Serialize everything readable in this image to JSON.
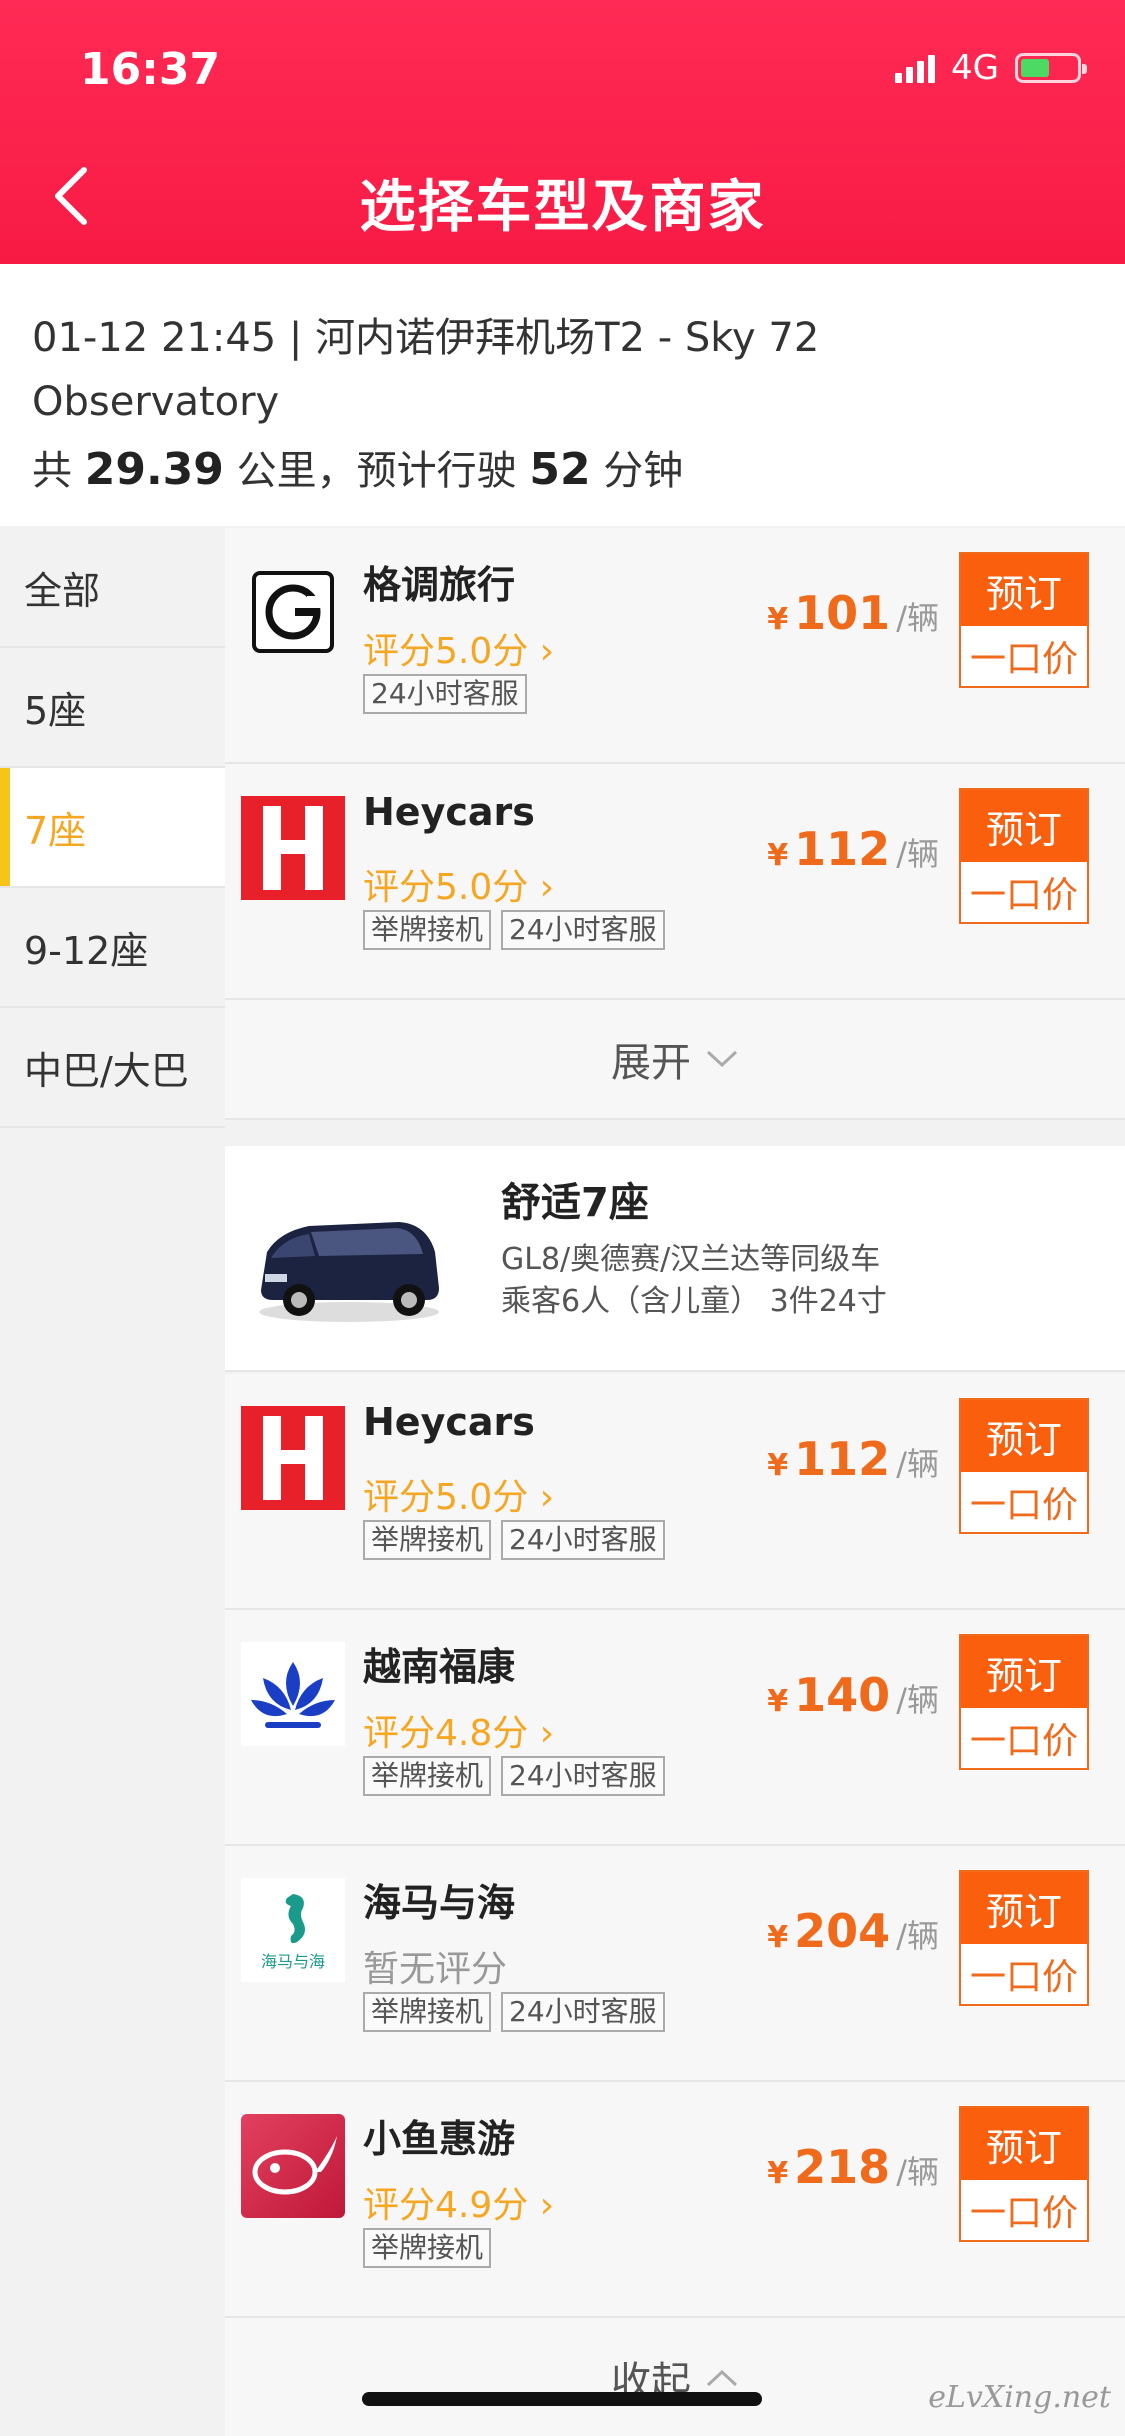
{
  "status": {
    "time": "16:37",
    "network": "4G"
  },
  "header": {
    "title": "选择车型及商家"
  },
  "trip": {
    "route": "01-12 21:45 | 河内诺伊拜机场T2 - Sky 72 Observatory",
    "summary_prefix": "共",
    "distance": "29.39",
    "distance_unit": "公里，预计行驶",
    "duration": "52",
    "duration_unit": "分钟"
  },
  "sidebar": {
    "items": [
      {
        "label": "全部"
      },
      {
        "label": "5座"
      },
      {
        "label": "7座"
      },
      {
        "label": "9-12座"
      },
      {
        "label": "中巴/大巴"
      }
    ],
    "active_index": 2
  },
  "group1": {
    "vendors": [
      {
        "name": "格调旅行",
        "rating": "评分5.0分",
        "tags": [
          "24小时客服"
        ],
        "currency": "¥",
        "price": "101",
        "unit": "/辆",
        "book": "预订",
        "fixed": "一口价"
      },
      {
        "name": "Heycars",
        "rating": "评分5.0分",
        "tags": [
          "举牌接机",
          "24小时客服"
        ],
        "currency": "¥",
        "price": "112",
        "unit": "/辆",
        "book": "预订",
        "fixed": "一口价"
      }
    ],
    "expand_label": "展开"
  },
  "car": {
    "title": "舒适7座",
    "models": "GL8/奥德赛/汉兰达等同级车",
    "capacity": "乘客6人（含儿童） 3件24寸"
  },
  "group2": {
    "vendors": [
      {
        "name": "Heycars",
        "rating": "评分5.0分",
        "tags": [
          "举牌接机",
          "24小时客服"
        ],
        "currency": "¥",
        "price": "112",
        "unit": "/辆",
        "book": "预订",
        "fixed": "一口价"
      },
      {
        "name": "越南福康",
        "rating": "评分4.8分",
        "tags": [
          "举牌接机",
          "24小时客服"
        ],
        "currency": "¥",
        "price": "140",
        "unit": "/辆",
        "book": "预订",
        "fixed": "一口价"
      },
      {
        "name": "海马与海",
        "rating": "暂无评分",
        "tags": [
          "举牌接机",
          "24小时客服"
        ],
        "currency": "¥",
        "price": "204",
        "unit": "/辆",
        "book": "预订",
        "fixed": "一口价",
        "logo_text": "海马与海"
      },
      {
        "name": "小鱼惠游",
        "rating": "评分4.9分",
        "tags": [
          "举牌接机"
        ],
        "currency": "¥",
        "price": "218",
        "unit": "/辆",
        "book": "预订",
        "fixed": "一口价"
      }
    ],
    "collapse_label": "收起"
  },
  "watermark": "eLvXing.net",
  "colors": {
    "header": "#ff2a55",
    "accent": "#fa5f0e",
    "rating": "#f5a623"
  }
}
